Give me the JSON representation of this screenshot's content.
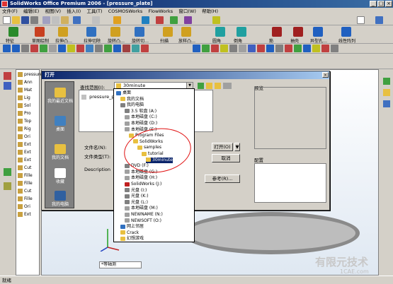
{
  "window": {
    "title": "SolidWorks Office Premium 2006 - [pressure_plate]",
    "controls": [
      "_",
      "□",
      "×"
    ]
  },
  "menu": [
    "文件(F)",
    "编辑(E)",
    "视图(V)",
    "插入(I)",
    "工具(T)",
    "COSMOSWorks",
    "FlowWorks",
    "窗口(W)",
    "帮助(H)"
  ],
  "toolbar": {
    "features": [
      {
        "label": "特征",
        "color": "#2a8a2a"
      },
      {
        "label": "草图绘制",
        "color": "#c84020"
      },
      {
        "label": "拉伸凸…",
        "color": "#d0a020"
      },
      {
        "label": "拉伸切除",
        "color": "#3070c0"
      },
      {
        "label": "旋转凸…",
        "color": "#d0a020"
      },
      {
        "label": "旋转切…",
        "color": "#3070c0"
      },
      {
        "label": "扫描",
        "color": "#d0a020"
      },
      {
        "label": "放样凸…",
        "color": "#d0a020"
      },
      {
        "label": "圆角",
        "color": "#20a0a0"
      },
      {
        "label": "倒角",
        "color": "#20a0a0"
      },
      {
        "label": "筋",
        "color": "#a02020"
      },
      {
        "label": "抽壳",
        "color": "#a02020"
      },
      {
        "label": "异型孔…",
        "color": "#2060c0"
      },
      {
        "label": "线性阵列",
        "color": "#2060c0"
      }
    ]
  },
  "tree": {
    "items": [
      "pressure",
      "Ann",
      "Mat",
      "Lig",
      "Sol",
      "Pro",
      "Top",
      "Rig",
      "Ori",
      "Ext",
      "Ext",
      "Ext",
      "Cut",
      "Fille",
      "Fille",
      "Cut",
      "Fille",
      "Ori",
      "Ext"
    ]
  },
  "dialog": {
    "title": "打开",
    "look_in_label": "查找范围(I):",
    "look_in_value": "30minute",
    "places": [
      "我的最近文档",
      "桌面",
      "我的文档",
      "收藏",
      "我的电脑"
    ],
    "files": [
      "pressure_plate"
    ],
    "filename_label": "文件名(N):",
    "filetype_label": "文件类型(T):",
    "description_label": "Description",
    "open_button": "打开(O)",
    "cancel_button": "取消",
    "refs_button": "参考(R)...",
    "preview_label": "预览",
    "config_label": "配置"
  },
  "dropdown": {
    "items": [
      {
        "label": "桌面",
        "indent": 0,
        "color": "#3070c0"
      },
      {
        "label": "我的文档",
        "indent": 1,
        "color": "#e8c040"
      },
      {
        "label": "我的电脑",
        "indent": 1,
        "color": "#808080"
      },
      {
        "label": "3.5 软盘 (A:)",
        "indent": 2,
        "color": "#808080"
      },
      {
        "label": "本地磁盘 (C:)",
        "indent": 2,
        "color": "#a0a0a0"
      },
      {
        "label": "本地磁盘 (D:)",
        "indent": 2,
        "color": "#a0a0a0"
      },
      {
        "label": "本地磁盘 (E:)",
        "indent": 2,
        "color": "#a0a0a0"
      },
      {
        "label": "Program Files",
        "indent": 3,
        "color": "#e8c040"
      },
      {
        "label": "SolidWorks",
        "indent": 4,
        "color": "#e8c040"
      },
      {
        "label": "samples",
        "indent": 5,
        "color": "#e8c040"
      },
      {
        "label": "tutorial",
        "indent": 6,
        "color": "#e8c040"
      },
      {
        "label": "30minute",
        "indent": 7,
        "color": "#e8c040",
        "selected": true
      },
      {
        "label": "DVD (F:)",
        "indent": 2,
        "color": "#808080"
      },
      {
        "label": "本地磁盘 (G:)",
        "indent": 2,
        "color": "#a0a0a0"
      },
      {
        "label": "本地磁盘 (H:)",
        "indent": 2,
        "color": "#a0a0a0"
      },
      {
        "label": "SolidWorks (J:)",
        "indent": 2,
        "color": "#c02020"
      },
      {
        "label": "光盘 (I:)",
        "indent": 2,
        "color": "#808080"
      },
      {
        "label": "光盘 (K:)",
        "indent": 2,
        "color": "#808080"
      },
      {
        "label": "光盘 (L:)",
        "indent": 2,
        "color": "#808080"
      },
      {
        "label": "本地磁盘 (M:)",
        "indent": 2,
        "color": "#a0a0a0"
      },
      {
        "label": "NEWNAME (N:)",
        "indent": 2,
        "color": "#a0a0a0"
      },
      {
        "label": "NEWSOFT (O:)",
        "indent": 2,
        "color": "#a0a0a0"
      },
      {
        "label": "网上邻居",
        "indent": 1,
        "color": "#3070c0"
      },
      {
        "label": "Crack",
        "indent": 1,
        "color": "#e8c040"
      },
      {
        "label": "幻想游戏",
        "indent": 1,
        "color": "#e8c040"
      }
    ]
  },
  "viewport": {
    "scale_value": "*等轴测"
  },
  "status": {
    "text": "就绪"
  },
  "watermark": {
    "main": "有限元技术",
    "sub": "1CAE.com"
  }
}
